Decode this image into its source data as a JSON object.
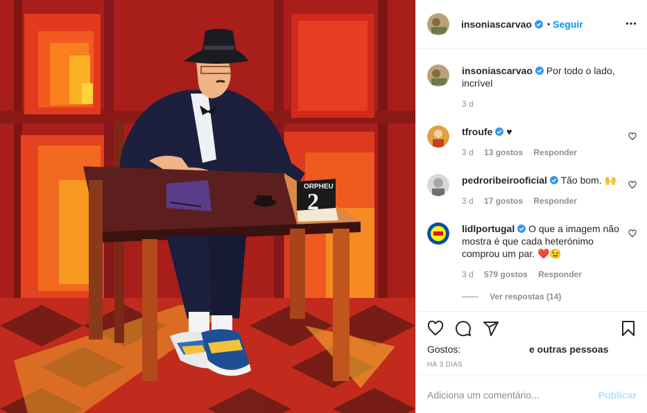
{
  "post": {
    "author": "insoniascarvao",
    "follow_label": "Seguir",
    "separator": "•",
    "more_icon": "more-horizontal-icon"
  },
  "caption": {
    "user": "insoniascarvao",
    "text": "Por todo o lado, incrível",
    "time": "3 d"
  },
  "comments": [
    {
      "user": "tfroufe",
      "text": "♥",
      "time": "3 d",
      "likes": "13 gostos",
      "reply": "Responder"
    },
    {
      "user": "pedroribeirooficial",
      "text": "Tão bom. 🙌",
      "time": "3 d",
      "likes": "17 gostos",
      "reply": "Responder"
    },
    {
      "user": "lidlportugal",
      "text": "O que a imagem não mostra é que cada heterónimo comprou um par. ❤️😉",
      "time": "3 d",
      "likes": "579 gostos",
      "reply": "Responder"
    }
  ],
  "view_replies": "Ver respostas (14)",
  "likes": {
    "label": "Gostos:",
    "others": "e outras pessoas"
  },
  "date": "HÁ 3 DIAS",
  "add_comment": {
    "placeholder": "Adiciona um comentário...",
    "publish_label": "Publicar"
  },
  "artwork": {
    "calendar_header": "ORPHEU",
    "calendar_number": "2"
  },
  "colors": {
    "accent": "#0095f6",
    "publish_disabled": "#b2dffc",
    "muted": "#8e8e8e",
    "border": "#efefef",
    "verified": "#3897f0"
  }
}
